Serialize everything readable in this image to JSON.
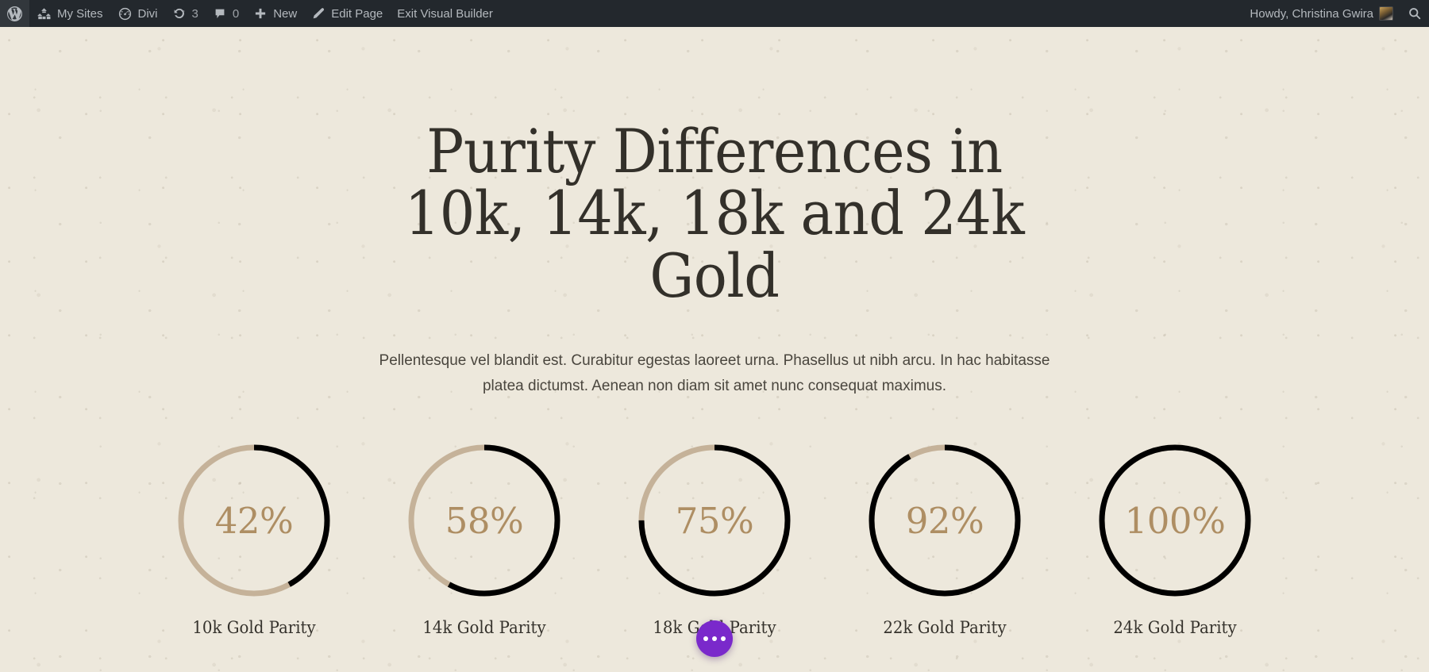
{
  "adminbar": {
    "items": [
      {
        "id": "wp-logo",
        "icon": "wordpress-icon",
        "label": "",
        "count": ""
      },
      {
        "id": "my-sites",
        "icon": "my-sites-icon",
        "label": "My Sites",
        "count": ""
      },
      {
        "id": "divi",
        "icon": "divi-icon",
        "label": "Divi",
        "count": ""
      },
      {
        "id": "updates",
        "icon": "updates-icon",
        "label": "",
        "count": "3"
      },
      {
        "id": "comments",
        "icon": "comment-icon",
        "label": "",
        "count": "0"
      },
      {
        "id": "new",
        "icon": "plus-icon",
        "label": "New",
        "count": ""
      },
      {
        "id": "edit-page",
        "icon": "pencil-icon",
        "label": "Edit Page",
        "count": ""
      },
      {
        "id": "exit-vb",
        "icon": "",
        "label": "Exit Visual Builder",
        "count": ""
      }
    ],
    "account_greeting": "Howdy, Christina Gwira",
    "avatar_name": "avatar",
    "search_icon": "search-icon",
    "bar_color": "#23282d",
    "text_color": "#b4b9be"
  },
  "page": {
    "background_color": "#EDE8DC",
    "headline": "Purity Differences in 10k, 14k, 18k and 24k Gold",
    "intro": "Pellentesque vel blandit est. Curabitur egestas laoreet urna. Phasellus ut nibh arcu. In hac habitasse platea dictumst. Aenean non diam sit amet nunc consequat maximus."
  },
  "chart_data": {
    "type": "pie",
    "title": "Purity Differences in 10k, 14k, 18k and 24k Gold",
    "categories": [
      "10k Gold Parity",
      "14k Gold Parity",
      "18k Gold Parity",
      "22k Gold Parity",
      "24k Gold Parity"
    ],
    "values": [
      42,
      58,
      75,
      92,
      100
    ],
    "value_labels": [
      "42%",
      "58%",
      "75%",
      "92%",
      "100%"
    ],
    "unit": "%",
    "ylim": [
      0,
      100
    ],
    "bar_color": "#000000",
    "track_color": "#C5B299",
    "number_color": "#AE8E63",
    "label_color": "#35322c",
    "legend": "none",
    "grid": false
  },
  "counters": [
    {
      "value": 42,
      "value_label": "42%",
      "label": "10k Gold Parity"
    },
    {
      "value": 58,
      "value_label": "58%",
      "label": "14k Gold Parity"
    },
    {
      "value": 75,
      "value_label": "75%",
      "label": "18k Gold Parity"
    },
    {
      "value": 92,
      "value_label": "92%",
      "label": "22k Gold Parity"
    },
    {
      "value": 100,
      "value_label": "100%",
      "label": "24k Gold Parity"
    }
  ],
  "divi_fab": {
    "name": "divi-visual-builder-menu-button",
    "color": "#7a29cb",
    "dots": 3
  }
}
